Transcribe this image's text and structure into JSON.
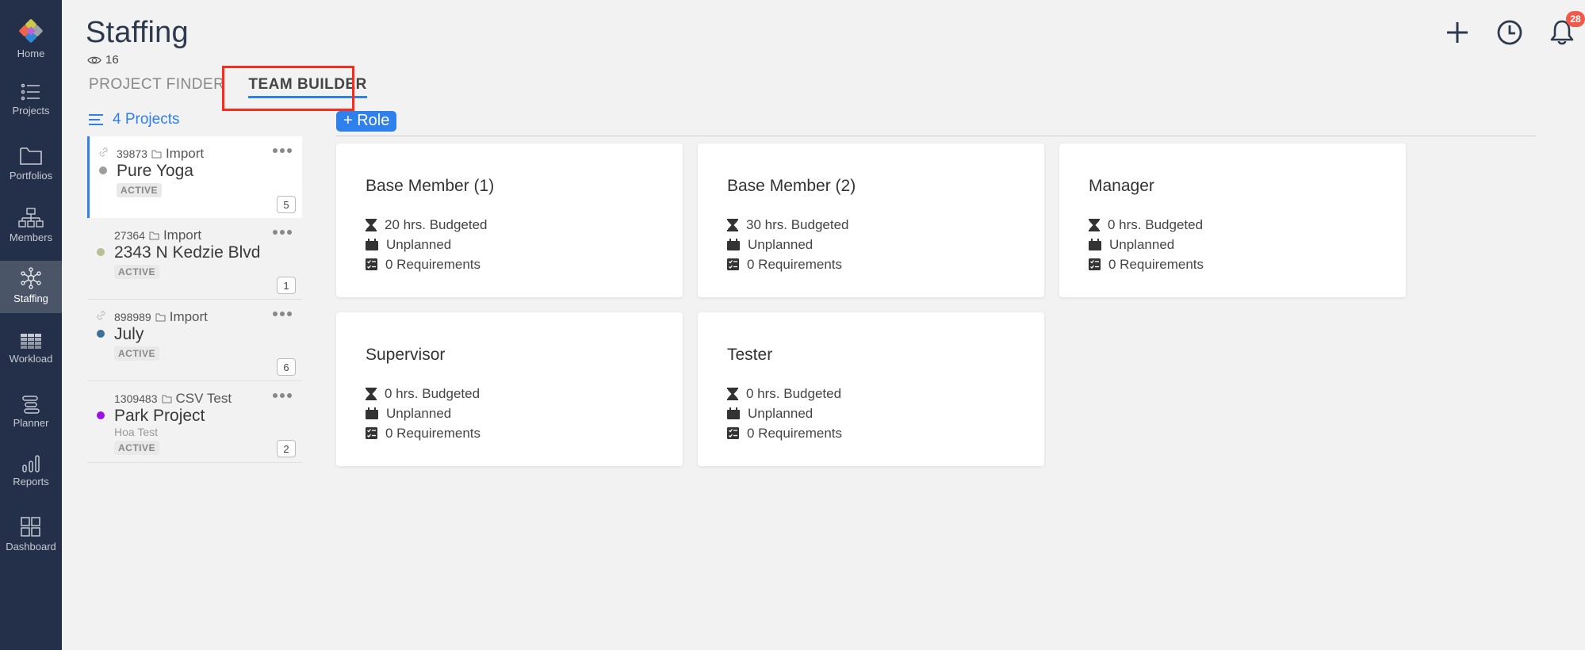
{
  "sidebar": {
    "items": [
      {
        "label": "Home",
        "icon": "logo-icon"
      },
      {
        "label": "Projects",
        "icon": "list-icon"
      },
      {
        "label": "Portfolios",
        "icon": "folder-icon"
      },
      {
        "label": "Members",
        "icon": "org-chart-icon"
      },
      {
        "label": "Staffing",
        "icon": "network-icon",
        "active": true
      },
      {
        "label": "Workload",
        "icon": "grid-icon"
      },
      {
        "label": "Planner",
        "icon": "gantt-icon"
      },
      {
        "label": "Reports",
        "icon": "bar-chart-icon"
      },
      {
        "label": "Dashboard",
        "icon": "dashboard-icon"
      }
    ]
  },
  "header": {
    "title": "Staffing",
    "viewers": "16",
    "notifications_count": "28"
  },
  "tabs": [
    {
      "label": "PROJECT FINDER",
      "active": false
    },
    {
      "label": "TEAM BUILDER",
      "active": true
    }
  ],
  "projects": {
    "header": "4 Projects",
    "items": [
      {
        "id": "39873",
        "folder": "Import",
        "name": "Pure Yoga",
        "sub": "",
        "status": "ACTIVE",
        "count": "5",
        "dot_color": "#9e9e9e",
        "linked": true,
        "selected": true
      },
      {
        "id": "27364",
        "folder": "Import",
        "name": "2343 N Kedzie Blvd",
        "sub": "",
        "status": "ACTIVE",
        "count": "1",
        "dot_color": "#b8bf92",
        "linked": false,
        "selected": false
      },
      {
        "id": "898989",
        "folder": "Import",
        "name": "July",
        "sub": "",
        "status": "ACTIVE",
        "count": "6",
        "dot_color": "#3d6f99",
        "linked": true,
        "selected": false
      },
      {
        "id": "1309483",
        "folder": "CSV Test",
        "name": "Park Project",
        "sub": "Hoa Test",
        "status": "ACTIVE",
        "count": "2",
        "dot_color": "#9b10e8",
        "linked": false,
        "selected": false
      }
    ]
  },
  "add_role_label": "+ Role",
  "roles": [
    {
      "title": "Base Member (1)",
      "budget": "20 hrs. Budgeted",
      "plan": "Unplanned",
      "requirements": "0 Requirements"
    },
    {
      "title": "Base Member (2)",
      "budget": "30 hrs. Budgeted",
      "plan": "Unplanned",
      "requirements": "0 Requirements"
    },
    {
      "title": "Manager",
      "budget": "0 hrs. Budgeted",
      "plan": "Unplanned",
      "requirements": "0 Requirements"
    },
    {
      "title": "Supervisor",
      "budget": "0 hrs. Budgeted",
      "plan": "Unplanned",
      "requirements": "0 Requirements"
    },
    {
      "title": "Tester",
      "budget": "0 hrs. Budgeted",
      "plan": "Unplanned",
      "requirements": "0 Requirements"
    }
  ],
  "colors": {
    "accent": "#2f80ed",
    "sidebar_bg": "#24304a",
    "badge": "#f05a4a",
    "highlight": "#ff2a1a"
  }
}
